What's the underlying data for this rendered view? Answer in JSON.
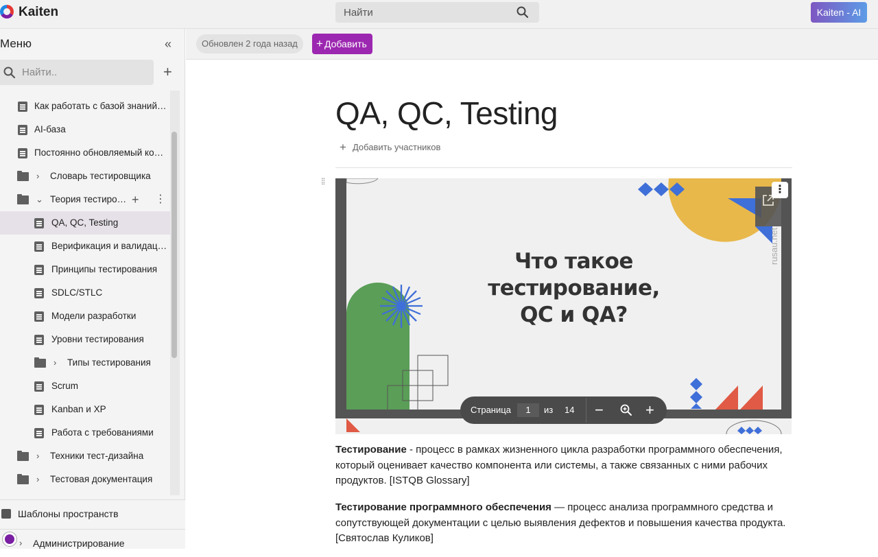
{
  "app": {
    "brand": "Kaiten",
    "search_placeholder": "Найти",
    "ai_button": "Kaiten - AI"
  },
  "sidebar": {
    "title": "Меню",
    "search_placeholder": "Найти..",
    "items": [
      {
        "label": "Как работать с базой знаний…",
        "type": "doc",
        "level": 0
      },
      {
        "label": "AI-база",
        "type": "doc",
        "level": 0
      },
      {
        "label": "Постоянно обновляемый ко…",
        "type": "doc",
        "level": 0
      },
      {
        "label": "Словарь тестировщика",
        "type": "folder",
        "level": 0,
        "expanded": false
      },
      {
        "label": "Теория тестирования",
        "type": "folder",
        "level": 0,
        "expanded": true
      },
      {
        "label": "QA, QC, Testing",
        "type": "doc",
        "level": 1,
        "active": true
      },
      {
        "label": "Верификация и валидац…",
        "type": "doc",
        "level": 1
      },
      {
        "label": "Принципы тестирования",
        "type": "doc",
        "level": 1
      },
      {
        "label": "SDLC/STLC",
        "type": "doc",
        "level": 1
      },
      {
        "label": "Модели разработки",
        "type": "doc",
        "level": 1
      },
      {
        "label": "Уровни тестирования",
        "type": "doc",
        "level": 1
      },
      {
        "label": "Типы тестирования",
        "type": "folder",
        "level": 1,
        "expanded": false
      },
      {
        "label": "Scrum",
        "type": "doc",
        "level": 1
      },
      {
        "label": "Kanban и XP",
        "type": "doc",
        "level": 1
      },
      {
        "label": "Работа с требованиями",
        "type": "doc",
        "level": 1
      },
      {
        "label": "Техники тест-дизайна",
        "type": "folder",
        "level": 0,
        "expanded": false
      },
      {
        "label": "Тестовая документация",
        "type": "folder",
        "level": 0,
        "expanded": false
      }
    ],
    "templates": "Шаблоны пространств",
    "admin": "Администрирование"
  },
  "toolbar": {
    "updated": "Обновлен 2 года назад",
    "add_button": "Добавить"
  },
  "document": {
    "title": "QA, QC, Testing",
    "add_members": "Добавить участников",
    "slide": {
      "title_lines": [
        "Что такое",
        "тестирование,",
        "QC и QA?"
      ],
      "watermark": "rusau.net"
    },
    "pdf_toolbar": {
      "page_label": "Страница",
      "page": "1",
      "of_label": "из",
      "total": "14"
    },
    "paragraphs": [
      {
        "bold": "Тестирование",
        "text": " - процесс в рамках жизненного цикла разработки программного обеспечения, который оценивает качество компонента или системы, а также связанных с ними рабочих продуктов. [ISTQB Glossary]"
      },
      {
        "bold": "Тестирование программного обеспечения",
        "text": " — процесс анализа программного средства и сопутствующей документации с целью выявления дефектов и повышения качества продукта. [Святослав Куликов]"
      }
    ]
  },
  "colors": {
    "accent": "#9c27b0",
    "ai_gradient_start": "#7e57c2",
    "ai_gradient_end": "#5c9ce6"
  }
}
